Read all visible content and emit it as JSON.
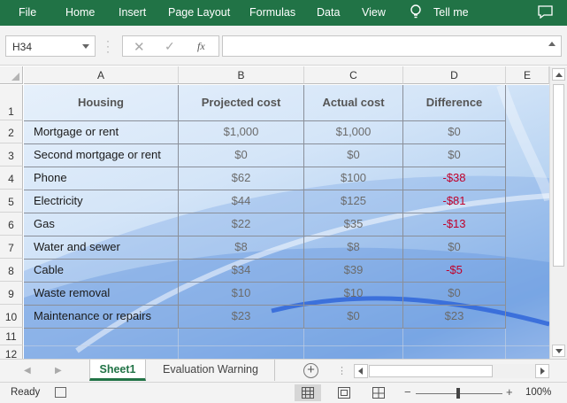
{
  "ribbon": {
    "tabs": [
      "File",
      "Home",
      "Insert",
      "Page Layout",
      "Formulas",
      "Data",
      "View",
      "Tell me"
    ],
    "tell_me_icon": "lightbulb-icon",
    "comments_icon": "comment-icon"
  },
  "formula_bar": {
    "name_box": "H34",
    "formula": ""
  },
  "columns": [
    "A",
    "B",
    "C",
    "D",
    "E"
  ],
  "rows": [
    "1",
    "2",
    "3",
    "4",
    "5",
    "6",
    "7",
    "8",
    "9",
    "10",
    "11",
    "12"
  ],
  "table": {
    "headers": [
      "Housing",
      "Projected cost",
      "Actual cost",
      "Difference"
    ],
    "data": [
      [
        "Mortgage or rent",
        "$1,000",
        "$1,000",
        "$0"
      ],
      [
        "Second mortgage or rent",
        "$0",
        "$0",
        "$0"
      ],
      [
        "Phone",
        "$62",
        "$100",
        "-$38"
      ],
      [
        "Electricity",
        "$44",
        "$125",
        "-$81"
      ],
      [
        "Gas",
        "$22",
        "$35",
        "-$13"
      ],
      [
        "Water and sewer",
        "$8",
        "$8",
        "$0"
      ],
      [
        "Cable",
        "$34",
        "$39",
        "-$5"
      ],
      [
        "Waste removal",
        "$10",
        "$10",
        "$0"
      ],
      [
        "Maintenance or repairs",
        "$23",
        "$0",
        "$23"
      ]
    ]
  },
  "sheets": {
    "active": "Sheet1",
    "other": "Evaluation Warning"
  },
  "status": {
    "ready": "Ready",
    "zoom": "100%",
    "zoom_minus": "−",
    "zoom_plus": "+"
  },
  "colors": {
    "ribbon": "#217346",
    "negative": "#c0002a"
  }
}
